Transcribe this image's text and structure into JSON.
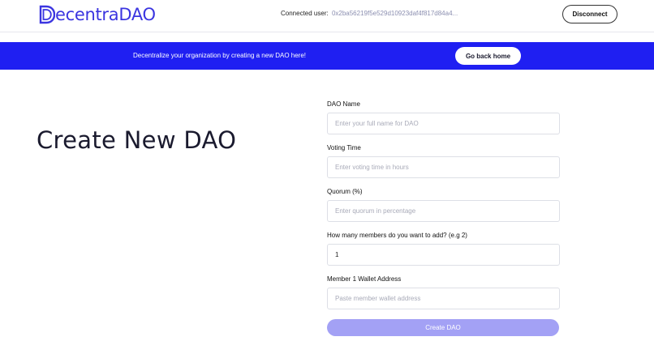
{
  "header": {
    "logo_text": "ecentraDAO",
    "connected_label": "Connected user:",
    "connected_address": "0x2ba56219f5e529d10923daf4f817d84a4...",
    "disconnect_label": "Disconnect"
  },
  "banner": {
    "text": "Decentralize your organization by creating a new DAO here!",
    "home_label": "Go back home"
  },
  "main": {
    "title": "Create New DAO"
  },
  "form": {
    "dao_name": {
      "label": "DAO Name",
      "placeholder": "Enter your full name for DAO",
      "value": ""
    },
    "voting_time": {
      "label": "Voting Time",
      "placeholder": "Enter voting time in hours",
      "value": ""
    },
    "quorum": {
      "label": "Quorum (%)",
      "placeholder": "Enter quorum in percentage",
      "value": ""
    },
    "members_count": {
      "label": "How many members do you want to add? (e.g 2)",
      "placeholder": "",
      "value": "1"
    },
    "member_1": {
      "label": "Member 1 Wallet Address",
      "placeholder": "Paste member wallet address",
      "value": ""
    },
    "submit_label": "Create DAO"
  },
  "colors": {
    "brand": "#3b35e0",
    "banner": "#1f1ff2",
    "submit_disabled": "#a3a1f5"
  },
  "icons": {
    "logo": "logo-d-icon"
  }
}
